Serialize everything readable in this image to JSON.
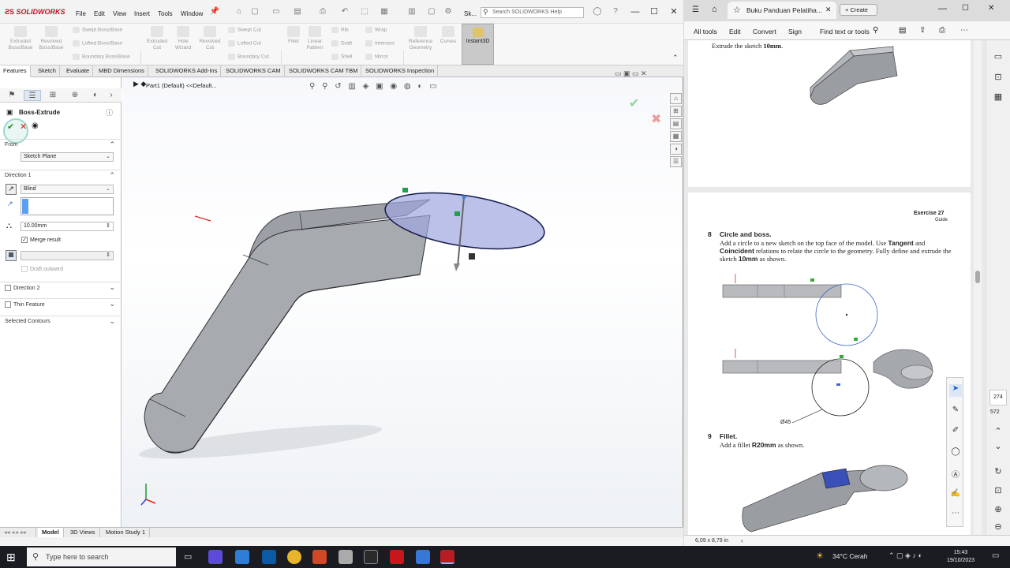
{
  "solidworks": {
    "brand": "SOLIDWORKS",
    "menu": [
      "File",
      "Edit",
      "View",
      "Insert",
      "Tools",
      "Window"
    ],
    "title_short": "Sk...",
    "search_placeholder": "Search SOLIDWORKS Help",
    "ribbon": {
      "extruded_boss": "Extruded Boss/Base",
      "revolved_boss": "Revolved Boss/Base",
      "swept_boss": "Swept Boss/Base",
      "lofted_boss": "Lofted Boss/Base",
      "boundary_boss": "Boundary Boss/Base",
      "extruded_cut": "Extruded Cut",
      "hole_wizard": "Hole Wizard",
      "revolved_cut": "Revolved Cut",
      "swept_cut": "Swept Cut",
      "lofted_cut": "Lofted Cut",
      "boundary_cut": "Boundary Cut",
      "fillet": "Fillet",
      "linear_pattern": "Linear Pattern",
      "rib": "Rib",
      "draft": "Draft",
      "shell": "Shell",
      "wrap": "Wrap",
      "intersect": "Intersect",
      "mirror": "Mirror",
      "reference_geometry": "Reference Geometry",
      "curves": "Curves",
      "instant3d": "Instant3D"
    },
    "tabs": [
      "Features",
      "Sketch",
      "Evaluate",
      "MBD Dimensions",
      "SOLIDWORKS Add-Ins",
      "SOLIDWORKS CAM",
      "SOLIDWORKS CAM TBM",
      "SOLIDWORKS Inspection"
    ],
    "tree_path": "Part1 (Default) <<Default...",
    "property_manager": {
      "title": "Boss-Extrude",
      "from_label": "From",
      "from_value": "Sketch Plane",
      "direction1_label": "Direction 1",
      "end_condition": "Blind",
      "depth": "10.00mm",
      "merge_result": "Merge result",
      "draft_outward": "Draft outward",
      "direction2": "Direction 2",
      "thin_feature": "Thin Feature",
      "selected_contours": "Selected Contours"
    },
    "bottom_tabs": [
      "Model",
      "3D Views",
      "Motion Study 1"
    ]
  },
  "pdf": {
    "tab_title": "Buku Panduan Pelatiha...",
    "new_tab": "Create",
    "toolbar": [
      "All tools",
      "Edit",
      "Convert",
      "Sign"
    ],
    "find": "Find text or tools",
    "page1_text_prefix": "Extrude the sketch ",
    "page1_text_bold": "10mm",
    "page1_text_suffix": ".",
    "exercise": "Exercise 27",
    "guide": "Guide",
    "step8_num": "8",
    "step8_title": "Circle and boss.",
    "step8_body_1": "Add a circle to a new sketch on the top face of the model. Use",
    "step8_tangent": "Tangent",
    "step8_and": "and",
    "step8_coincident": "Coincident",
    "step8_body_2": "relations to relate the circle to the geometry. Fully",
    "step8_body_3": "define and extrude the sketch",
    "step8_10mm": "10mm",
    "step8_body_4": "as shown.",
    "dim_label": "Ø45",
    "step9_num": "9",
    "step9_title": "Fillet.",
    "step9_body_1": "Add a fillet",
    "step9_r20": "R20mm",
    "step9_body_2": "as shown.",
    "page_current": "274",
    "page_total": "572",
    "page_size": "6,09 x 8,79 in"
  },
  "taskbar": {
    "search_placeholder": "Type here to search",
    "weather": "34°C  Cerah",
    "time": "15:43",
    "date": "19/10/2023"
  }
}
